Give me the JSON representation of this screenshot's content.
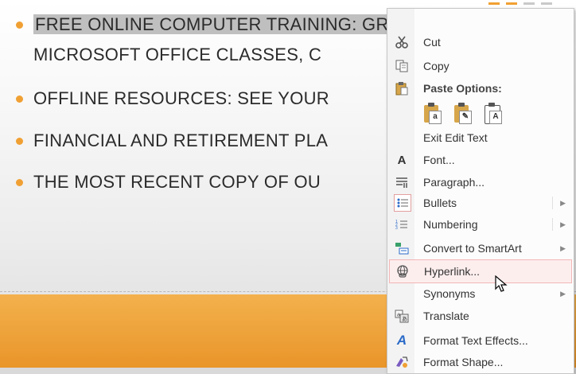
{
  "slide": {
    "bullets": [
      {
        "line1": "FREE ONLINE COMPUTER TRAINING: GREAT WEBS",
        "selected": true
      },
      {
        "line1": "MICROSOFT OFFICE CLASSES, C"
      },
      {
        "line1": "OFFLINE RESOURCES: SEE YOUR"
      },
      {
        "line1": "FINANCIAL AND RETIREMENT PLA"
      },
      {
        "line1": "THE MOST RECENT COPY OF OU"
      }
    ],
    "accent_color": "#f0a033",
    "band_color": "#e9952a"
  },
  "context_menu": {
    "cut": {
      "label": "Cut",
      "icon": "scissors-icon"
    },
    "copy": {
      "label": "Copy",
      "icon": "copy-icon"
    },
    "paste_options": {
      "label": "Paste Options:",
      "icon": "paste-icon"
    },
    "paste_buttons": [
      "keep-source-formatting",
      "merge-formatting",
      "keep-text-only"
    ],
    "paste_glyphs": [
      "a",
      "✎",
      "A"
    ],
    "exit_edit_text": {
      "label": "Exit Edit Text"
    },
    "font": {
      "label": "Font...",
      "icon_glyph": "A"
    },
    "paragraph": {
      "label": "Paragraph...",
      "icon": "paragraph-icon"
    },
    "bullets": {
      "label": "Bullets",
      "icon": "bullets-icon"
    },
    "numbering": {
      "label": "Numbering",
      "icon": "numbering-icon"
    },
    "convert_smartart": {
      "label": "Convert to SmartArt",
      "icon": "smartart-icon"
    },
    "hyperlink": {
      "label": "Hyperlink...",
      "icon": "hyperlink-icon"
    },
    "synonyms": {
      "label": "Synonyms"
    },
    "translate": {
      "label": "Translate",
      "icon": "translate-icon"
    },
    "format_text_effects": {
      "label": "Format Text Effects...",
      "icon_glyph": "A"
    },
    "format_shape": {
      "label": "Format Shape...",
      "icon": "format-shape-icon"
    },
    "submenu_arrow": "▶"
  }
}
